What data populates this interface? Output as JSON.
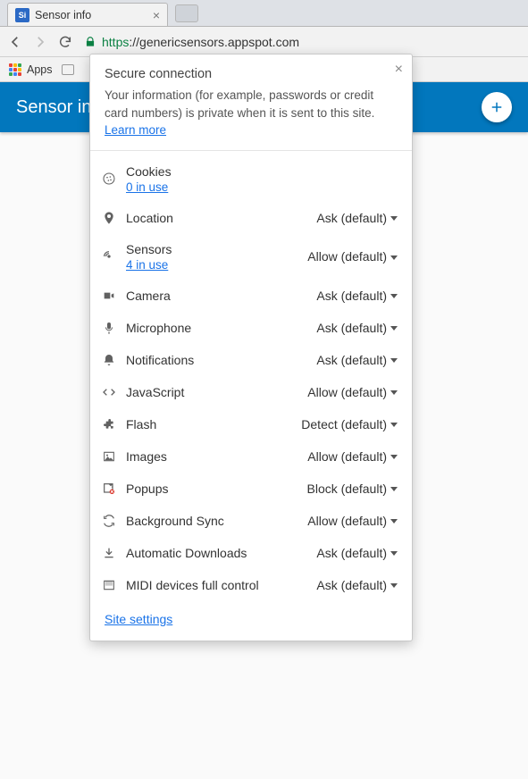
{
  "tab": {
    "title": "Sensor info",
    "favicon_text": "Si"
  },
  "address": {
    "scheme": "https",
    "rest": "://genericsensors.appspot.com"
  },
  "bookmarks": {
    "apps_label": "Apps"
  },
  "page": {
    "app_title": "Sensor info"
  },
  "popover": {
    "title": "Secure connection",
    "description_pre": "Your information (for example, passwords or credit card numbers) is private when it is sent to this site. ",
    "learn_more": "Learn more",
    "site_settings": "Site settings"
  },
  "permissions": [
    {
      "icon": "cookie",
      "label": "Cookies",
      "sub": "0 in use",
      "value": ""
    },
    {
      "icon": "location",
      "label": "Location",
      "sub": "",
      "value": "Ask (default)"
    },
    {
      "icon": "sensors",
      "label": "Sensors",
      "sub": "4 in use",
      "value": "Allow (default)"
    },
    {
      "icon": "camera",
      "label": "Camera",
      "sub": "",
      "value": "Ask (default)"
    },
    {
      "icon": "mic",
      "label": "Microphone",
      "sub": "",
      "value": "Ask (default)"
    },
    {
      "icon": "bell",
      "label": "Notifications",
      "sub": "",
      "value": "Ask (default)"
    },
    {
      "icon": "code",
      "label": "JavaScript",
      "sub": "",
      "value": "Allow (default)"
    },
    {
      "icon": "puzzle",
      "label": "Flash",
      "sub": "",
      "value": "Detect (default)"
    },
    {
      "icon": "image",
      "label": "Images",
      "sub": "",
      "value": "Allow (default)"
    },
    {
      "icon": "popup",
      "label": "Popups",
      "sub": "",
      "value": "Block (default)"
    },
    {
      "icon": "sync",
      "label": "Background Sync",
      "sub": "",
      "value": "Allow (default)"
    },
    {
      "icon": "download",
      "label": "Automatic Downloads",
      "sub": "",
      "value": "Ask (default)"
    },
    {
      "icon": "midi",
      "label": "MIDI devices full control",
      "sub": "",
      "value": "Ask (default)"
    }
  ]
}
